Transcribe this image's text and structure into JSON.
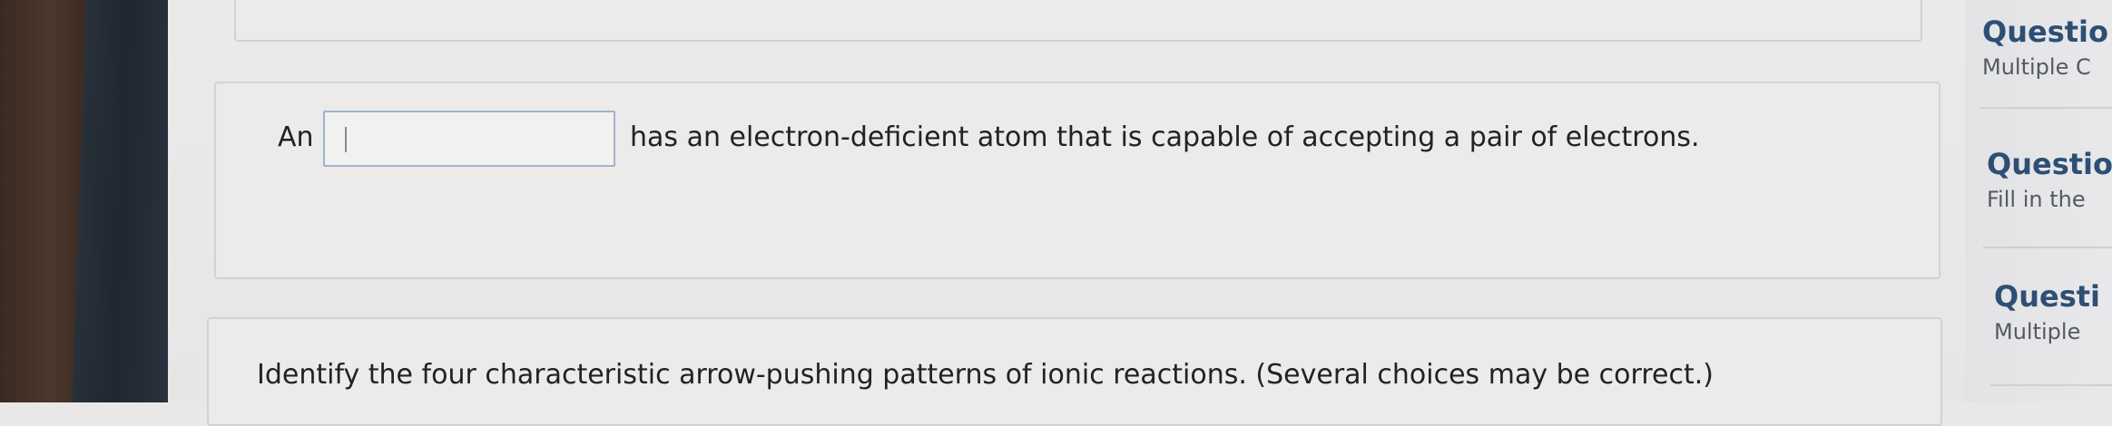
{
  "question_1": {
    "prefix": "An",
    "blank_value": "",
    "suffix": "has an electron-deficient atom that is capable of accepting a pair of electrons."
  },
  "question_2": {
    "text": "Identify the four characteristic arrow-pushing patterns of ionic reactions. (Several choices may be correct.)"
  },
  "sidebar": {
    "items": [
      {
        "title": "Questio",
        "subtitle": "Multiple C"
      },
      {
        "title": "Questio",
        "subtitle": "Fill in the"
      },
      {
        "title": "Questi",
        "subtitle": "Multiple"
      }
    ]
  }
}
